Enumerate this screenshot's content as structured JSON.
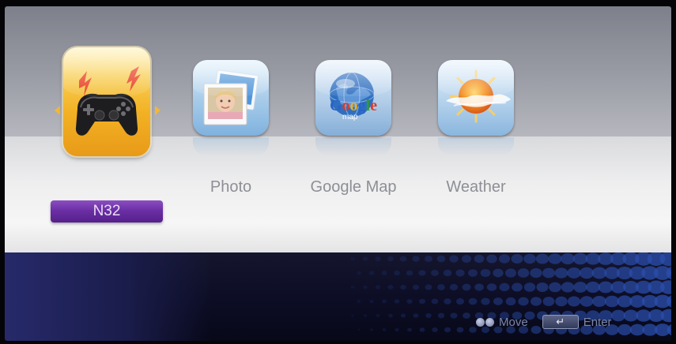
{
  "apps": [
    {
      "id": "n32",
      "label": "N32",
      "icon": "gamepad-icon",
      "selected": true
    },
    {
      "id": "photo",
      "label": "Photo",
      "icon": "photo-icon",
      "selected": false
    },
    {
      "id": "google-map",
      "label": "Google Map",
      "icon": "google-map-icon",
      "selected": false,
      "icon_text": "Google",
      "icon_subtext": "map"
    },
    {
      "id": "weather",
      "label": "Weather",
      "icon": "weather-icon",
      "selected": false
    }
  ],
  "hints": {
    "move_label": "Move",
    "enter_label": "Enter",
    "enter_key_glyph": "↵"
  },
  "colors": {
    "selected_tile": "#f2b124",
    "label_bar": "#6c2fa6",
    "label_text": "#8d8f95"
  }
}
